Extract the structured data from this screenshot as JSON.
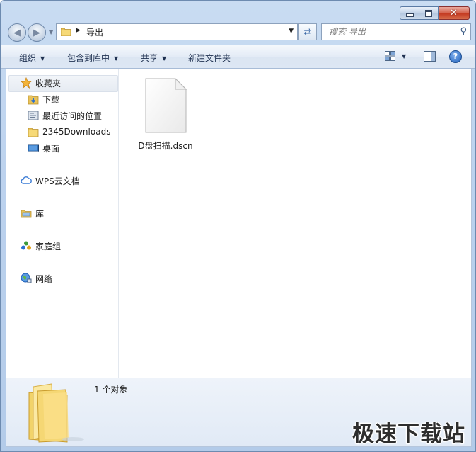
{
  "window": {
    "caption_buttons": {
      "minimize_icon": "minimize-icon",
      "maximize_icon": "maximize-icon",
      "close_icon": "close-icon"
    }
  },
  "navigation": {
    "back_icon": "back-arrow-icon",
    "forward_icon": "forward-arrow-icon",
    "address": {
      "crumb": "导出",
      "folder_icon": "folder-icon"
    },
    "refresh_icon": "refresh-icon",
    "search": {
      "placeholder": "搜索 导出",
      "icon": "search-icon"
    }
  },
  "toolbar": {
    "organize": "组织",
    "include_in_library": "包含到库中",
    "share": "共享",
    "new_folder": "新建文件夹",
    "view_icon": "view-options-icon",
    "preview_pane_icon": "preview-pane-icon",
    "help_icon": "help-icon"
  },
  "sidebar": {
    "favorites": {
      "label": "收藏夹",
      "items": [
        {
          "label": "下载",
          "icon": "downloads-folder-icon"
        },
        {
          "label": "最近访问的位置",
          "icon": "recent-places-icon"
        },
        {
          "label": "2345Downloads",
          "icon": "folder-icon"
        },
        {
          "label": "桌面",
          "icon": "desktop-icon"
        }
      ]
    },
    "groups": [
      {
        "label": "WPS云文档",
        "icon": "cloud-icon"
      },
      {
        "label": "库",
        "icon": "library-icon"
      },
      {
        "label": "家庭组",
        "icon": "homegroup-icon"
      },
      {
        "label": "网络",
        "icon": "network-icon"
      }
    ]
  },
  "files": [
    {
      "name": "D盘扫描.dscn",
      "icon": "generic-file-icon"
    }
  ],
  "details": {
    "count": "1 个对象",
    "icon": "folder-large-icon"
  },
  "watermark": "极速下载站",
  "colors": {
    "selection": "#e6ebf2",
    "frame": "#bcd2ee",
    "accent": "#1f5fb8"
  }
}
